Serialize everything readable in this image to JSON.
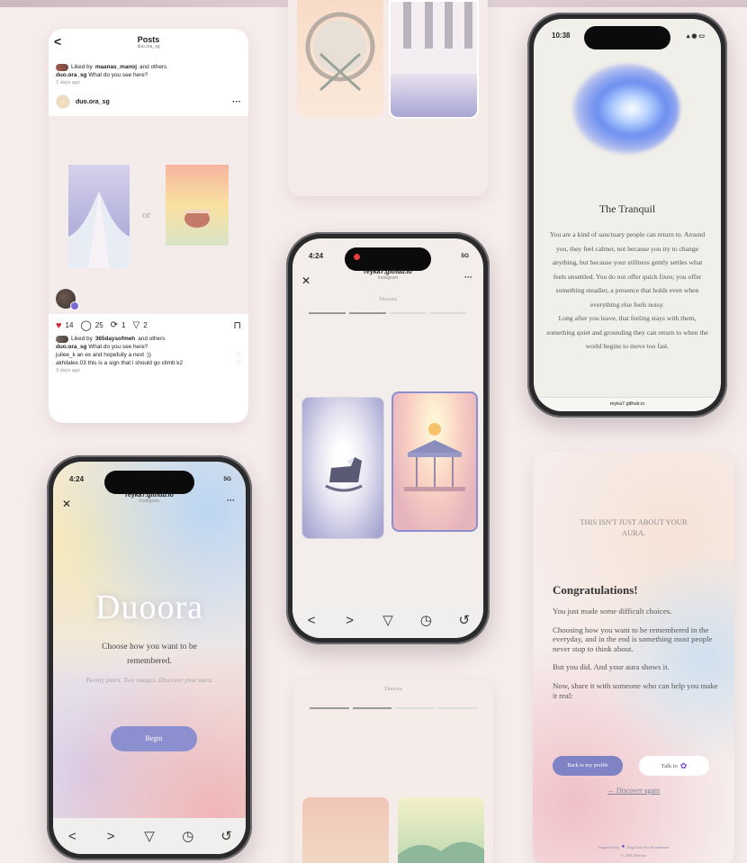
{
  "posts_card": {
    "back_glyph": "<",
    "title": "Posts",
    "subtitle": "duo.ora_sg",
    "top_liked_prefix": "Liked by",
    "top_liked_user": "maanas_manoj",
    "top_liked_suffix": "and others",
    "top_caption_user": "duo.ora_sg",
    "top_caption": "What do you see here?",
    "top_time": "2 days ago",
    "post_user": "duo.ora_sg",
    "more_glyph": "···",
    "or_label": "or",
    "likes": "14",
    "comments": "25",
    "reposts": "1",
    "shares": "2",
    "liked_prefix": "Liked by",
    "liked_user": "365daysofmeh",
    "liked_suffix": "and others",
    "caption_user": "duo.ora_sg",
    "caption": "What do you see here?",
    "comment1_user": "juilee_k",
    "comment1": "an ex and hopefully a next :))",
    "comment2_user": "akhilalex.03",
    "comment2": "this is a sign that i should go climb k2",
    "time": "3 days ago"
  },
  "tranquil_phone": {
    "time": "10:38",
    "title": "The Tranquil",
    "body": "You are a kind of sanctuary people can return to. Around you, they feel calmer, not because you try to change anything, but because your stillness gently settles what feels unsettled. You do not offer quick fixes; you offer something steadier, a presence that holds even when everything else feels noisy.",
    "body2": "Long after you leave, that feeling stays with them, something quiet and grounding they can return to when the world begins to move too fast.",
    "url": "reyka7.github.io"
  },
  "center_phone": {
    "time": "4:24",
    "signal": "5G",
    "url": "reyka7.github.io",
    "app": "Instagram",
    "brand": "Duoora",
    "close": "✕",
    "more": "···",
    "nav": [
      "<",
      ">",
      "▽",
      "◷",
      "↺"
    ]
  },
  "intro_phone": {
    "time": "4:24",
    "signal": "5G",
    "url": "reyka7.github.io",
    "app": "Instagram",
    "close": "✕",
    "more": "···",
    "logo": "Duoora",
    "headline": "Choose how you want to be remembered.",
    "sub": "Twenty pairs. Two images. Discover your aura.",
    "begin": "Begin",
    "nav": [
      "<",
      ">",
      "▽",
      "◷",
      "↺"
    ]
  },
  "bottom_card": {
    "brand": "Duoora"
  },
  "congrats_card": {
    "eyebrow": "THIS ISN'T JUST ABOUT YOUR AURA.",
    "title": "Congratulations!",
    "p1": "You just made some difficult choices.",
    "p2": "Choosing how you want to be remembered in the everyday, and in the end is something most people never stop to think about.",
    "p3": "But you did. And your aura shows it.",
    "p4": "Now, share it with someone who can help you make it real:",
    "btn_profile": "Back to my profile",
    "btn_talk": "Talk to",
    "discover": "← Discover again",
    "footer1": "Supported by",
    "footer1b": "Ang Chin Not Foundation",
    "footer2": "© 2026 Duoora"
  },
  "colors": {
    "accent": "#8c8fcf",
    "heart": "#d3263c"
  }
}
